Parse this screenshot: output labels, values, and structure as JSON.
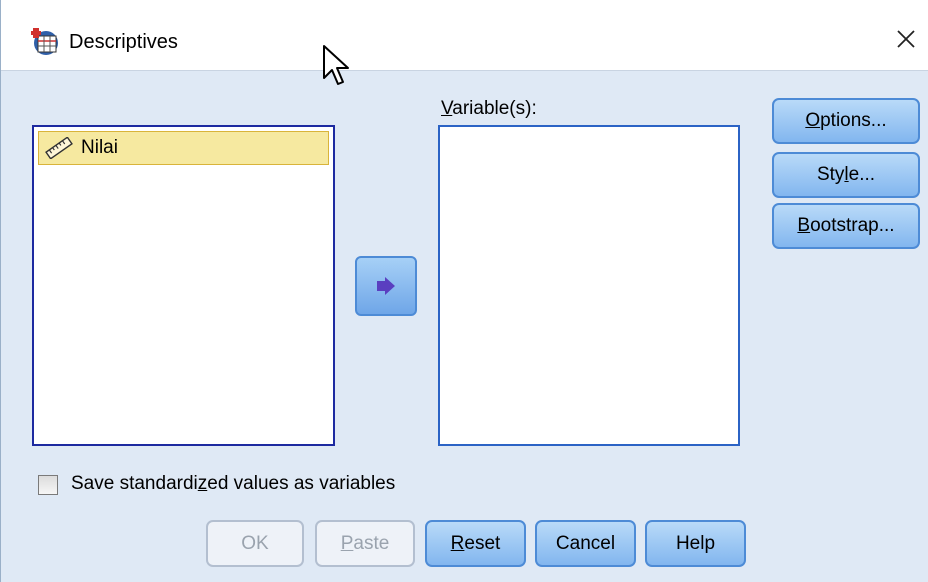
{
  "window": {
    "title": "Descriptives",
    "close_glyph": "✕"
  },
  "source_list": {
    "items": [
      {
        "label": "Nilai",
        "icon": "scale-ruler-icon",
        "selected": true
      }
    ]
  },
  "target_list": {
    "label_prefix": "",
    "label_mnemonic": "V",
    "label_rest": "ariable(s):",
    "items": []
  },
  "side_buttons": {
    "options_mnemonic": "O",
    "options_rest": "ptions...",
    "style_pre": "Sty",
    "style_mnemonic": "l",
    "style_rest": "e...",
    "bootstrap_mnemonic": "B",
    "bootstrap_rest": "ootstrap..."
  },
  "checkbox": {
    "label_pre": "Save standardi",
    "label_mnemonic": "z",
    "label_rest": "ed values as variables",
    "checked": false
  },
  "bottom_buttons": {
    "ok_label": "OK",
    "paste_mnemonic": "P",
    "paste_rest": "aste",
    "reset_mnemonic": "R",
    "reset_rest": "eset",
    "cancel_label": "Cancel",
    "help_label": "Help"
  },
  "colors": {
    "accent_border": "#4d8bd6",
    "selected_item_bg": "#f6e9a0",
    "list_border": "#1d2aa0",
    "dialog_bg": "#dfe9f5"
  }
}
